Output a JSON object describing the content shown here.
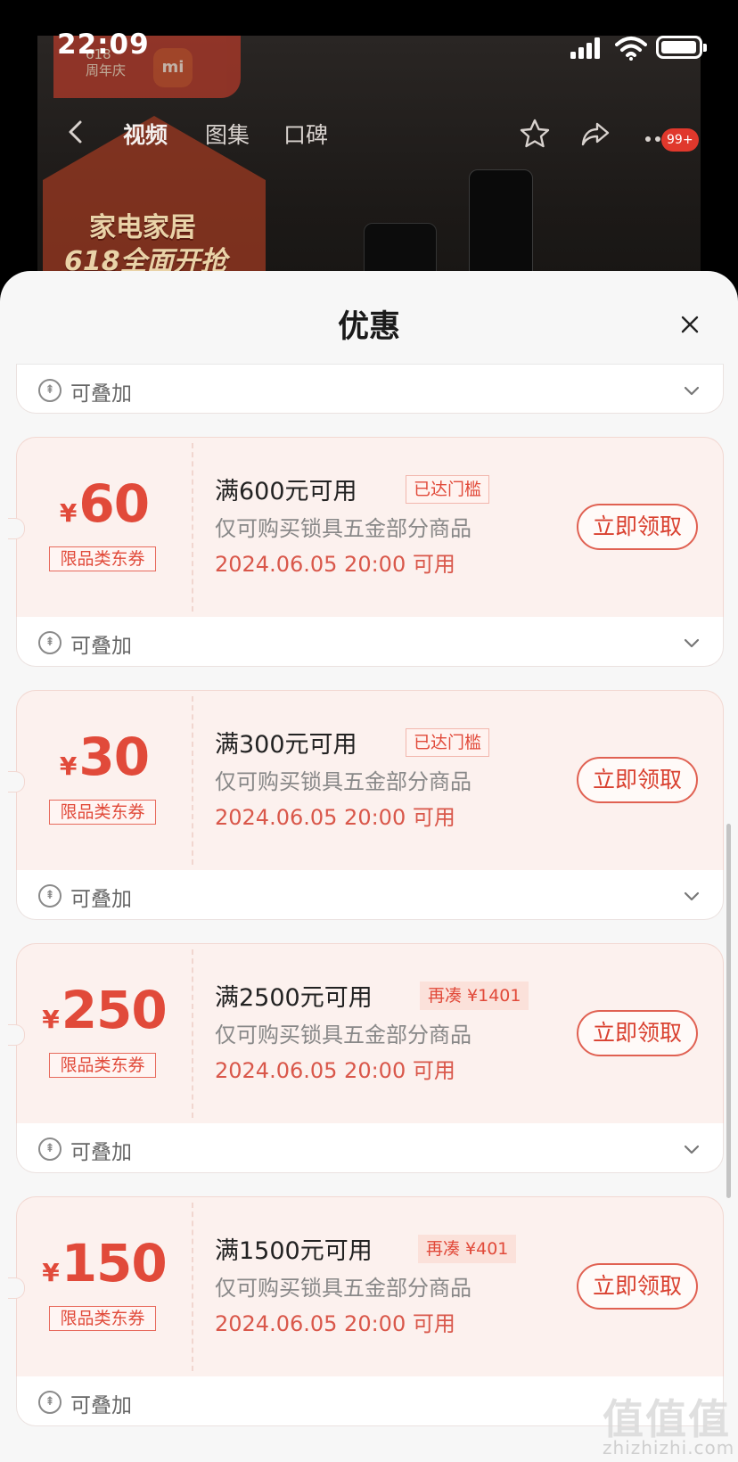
{
  "status": {
    "time": "22:09",
    "battery_level": 0.85
  },
  "background": {
    "anniversary": "618\n周年庆",
    "brand_logo": "mi",
    "promo_line1": "家电家居",
    "promo_line2": "618全面开抢",
    "tabs": [
      {
        "label": "视频",
        "active": true
      },
      {
        "label": "图集",
        "active": false
      },
      {
        "label": "口碑",
        "active": false
      }
    ],
    "more_badge": "99+"
  },
  "sheet": {
    "title": "优惠",
    "stack_label": "可叠加",
    "stack_icon": "stack-coupon-icon",
    "coupons": [
      {
        "yen": "¥",
        "amount": "60",
        "type": "限品类东券",
        "title": "满600元可用",
        "badge": "已达门槛",
        "badge_fill": false,
        "desc": "仅可购买锁具五金部分商品",
        "date": "2024.06.05 20:00 可用",
        "action": "立即领取"
      },
      {
        "yen": "¥",
        "amount": "30",
        "type": "限品类东券",
        "title": "满300元可用",
        "badge": "已达门槛",
        "badge_fill": false,
        "desc": "仅可购买锁具五金部分商品",
        "date": "2024.06.05 20:00 可用",
        "action": "立即领取"
      },
      {
        "yen": "¥",
        "amount": "250",
        "type": "限品类东券",
        "title": "满2500元可用",
        "badge": "再凑 ¥1401",
        "badge_fill": true,
        "desc": "仅可购买锁具五金部分商品",
        "date": "2024.06.05 20:00 可用",
        "action": "立即领取"
      },
      {
        "yen": "¥",
        "amount": "150",
        "type": "限品类东券",
        "title": "满1500元可用",
        "badge": "再凑 ¥401",
        "badge_fill": true,
        "desc": "仅可购买锁具五金部分商品",
        "date": "2024.06.05 20:00 可用",
        "action": "立即领取"
      }
    ]
  },
  "watermark": {
    "logo": "值值值",
    "site": "zhizhizhi.com"
  },
  "colors": {
    "accent": "#e14a3a",
    "coupon_bg": "#fcf1ee",
    "sheet_bg": "#f7f7f7"
  }
}
